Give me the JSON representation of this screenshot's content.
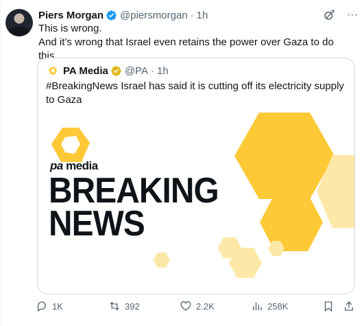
{
  "tweet": {
    "author_name": "Piers Morgan",
    "handle": "@piersmorgan",
    "time": "1h",
    "separator": "·",
    "text_line1": "This is wrong.",
    "text_line2": "And it’s wrong that Israel even retains the power over Gaza to do this.",
    "more_icon_glyph": "···"
  },
  "quote": {
    "author_name": "PA Media",
    "handle": "@PA",
    "time": "1h",
    "separator": "·",
    "text": "#BreakingNews Israel has said it is cutting off its electricity supply to Gaza",
    "media": {
      "brand_prefix": "pa",
      "brand_suffix": "media",
      "headline_line1": "BREAKING",
      "headline_line2": "NEWS"
    }
  },
  "actions": {
    "replies": "1K",
    "reposts": "392",
    "likes": "2.2K",
    "views": "258K"
  },
  "colors": {
    "verified_blue": "#1d9bf0",
    "verified_gold": "#e2b719",
    "muted_text": "#536471",
    "primary_text": "#0f1419",
    "hex_yellow": "#fdc936",
    "hex_light": "#fde8a7",
    "border": "#cfd9de"
  },
  "icons": {
    "verified": "verified-badge-icon",
    "gold_verified": "gold-verified-badge-icon",
    "grok": "grok-icon",
    "more": "more-icon",
    "reply": "reply-icon",
    "repost": "repost-icon",
    "like": "like-icon",
    "views": "views-icon",
    "bookmark": "bookmark-icon",
    "share": "share-icon"
  }
}
